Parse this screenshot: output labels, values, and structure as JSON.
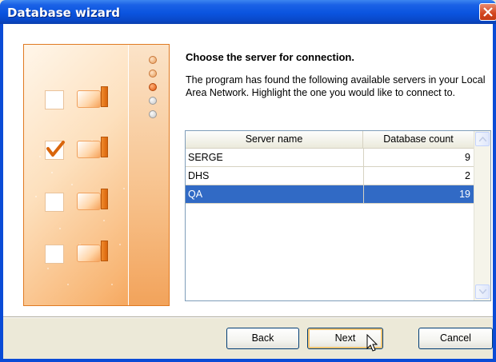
{
  "window": {
    "title": "Database wizard"
  },
  "steps": [
    "done",
    "done",
    "active",
    "todo",
    "todo"
  ],
  "heading": "Choose the server for connection.",
  "description": "The program has found the following available servers in your Local Area Network. Highlight the one you would like to connect to.",
  "table": {
    "columns": [
      "Server name",
      "Database count"
    ],
    "rows": [
      {
        "name": "SERGE",
        "count": "9",
        "selected": false
      },
      {
        "name": "DHS",
        "count": "2",
        "selected": false
      },
      {
        "name": "QA",
        "count": "19",
        "selected": true
      }
    ]
  },
  "buttons": {
    "back": "Back",
    "next": "Next",
    "cancel": "Cancel"
  },
  "icons": [
    "close-icon",
    "checkmark-icon",
    "computer-icon",
    "mouse-cursor-icon",
    "scroll-up-icon",
    "scroll-down-icon"
  ],
  "colors": {
    "titlebar": "#0a54df",
    "selection": "#316ac5",
    "accent": "#e0560f"
  }
}
